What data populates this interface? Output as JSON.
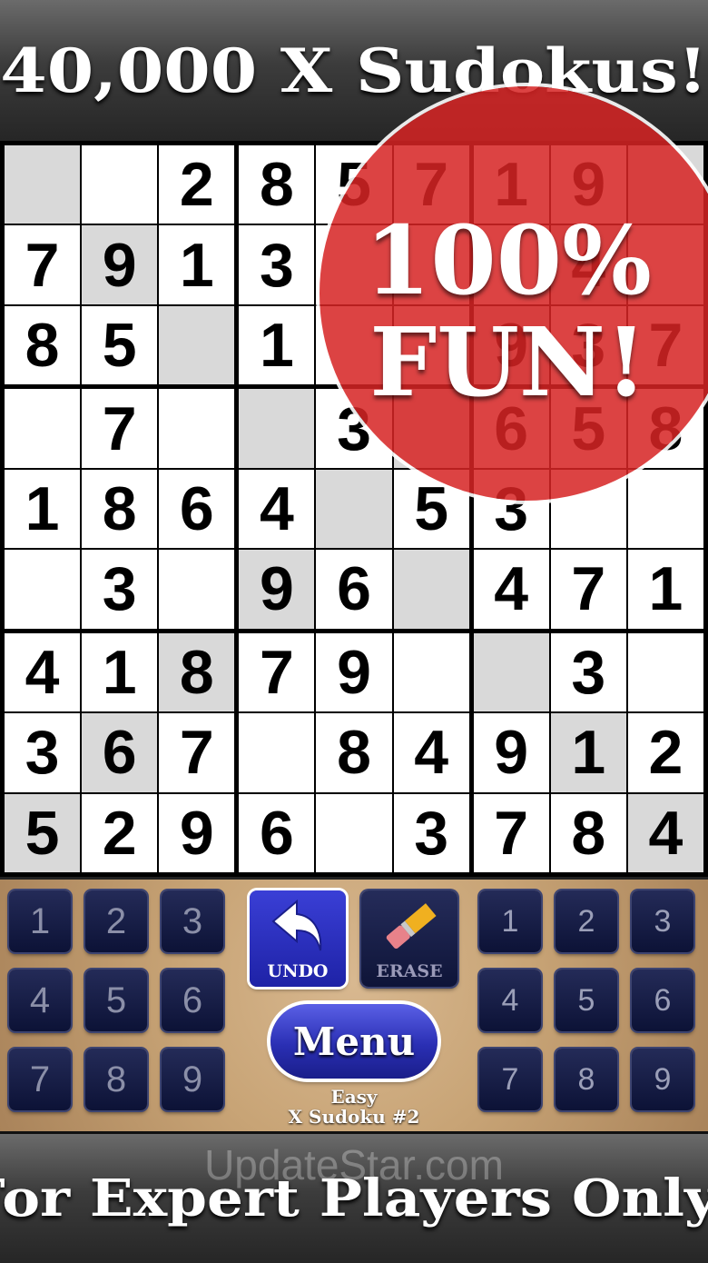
{
  "header": {
    "title": "40,000 X Sudokus!"
  },
  "footer": {
    "tagline": "For Expert Players Only!"
  },
  "badge": {
    "line1": "100%",
    "line2": "FUN!"
  },
  "board": {
    "rows": [
      [
        "",
        "",
        "2",
        "8",
        "5",
        "7",
        "1",
        "9",
        ""
      ],
      [
        "7",
        "9",
        "1",
        "3",
        "",
        "",
        "",
        "4",
        ""
      ],
      [
        "8",
        "5",
        "",
        "1",
        "",
        "",
        "9",
        "3",
        "7"
      ],
      [
        "",
        "7",
        "",
        "",
        "3",
        "",
        "6",
        "5",
        "8"
      ],
      [
        "1",
        "8",
        "6",
        "4",
        "",
        "5",
        "3",
        "",
        ""
      ],
      [
        "",
        "3",
        "",
        "9",
        "6",
        "",
        "4",
        "7",
        "1"
      ],
      [
        "4",
        "1",
        "8",
        "7",
        "9",
        "",
        "",
        "3",
        ""
      ],
      [
        "3",
        "6",
        "7",
        "",
        "8",
        "4",
        "9",
        "1",
        "2"
      ],
      [
        "5",
        "2",
        "9",
        "6",
        "",
        "3",
        "7",
        "8",
        "4"
      ]
    ],
    "shaded_cells": [
      [
        0,
        0
      ],
      [
        1,
        1
      ],
      [
        2,
        2
      ],
      [
        3,
        3
      ],
      [
        4,
        4
      ],
      [
        5,
        5
      ],
      [
        6,
        6
      ],
      [
        7,
        7
      ],
      [
        8,
        8
      ],
      [
        0,
        8
      ],
      [
        1,
        7
      ],
      [
        2,
        6
      ],
      [
        3,
        5
      ],
      [
        4,
        4
      ],
      [
        5,
        3
      ],
      [
        6,
        2
      ],
      [
        7,
        1
      ],
      [
        8,
        0
      ]
    ]
  },
  "keypad_left": [
    "1",
    "2",
    "3",
    "4",
    "5",
    "6",
    "7",
    "8",
    "9"
  ],
  "keypad_right": [
    "1",
    "2",
    "3",
    "4",
    "5",
    "6",
    "7",
    "8",
    "9"
  ],
  "controls": {
    "undo_label": "UNDO",
    "erase_label": "ERASE",
    "menu_label": "Menu"
  },
  "level": {
    "difficulty": "Easy",
    "puzzle": "X Sudoku #2"
  },
  "watermark": "UpdateStar.com",
  "colors": {
    "badge_red": "#d62424",
    "button_blue": "#2a2fb4",
    "key_navy": "#141a44",
    "shade_gray": "#d9d9d9"
  }
}
